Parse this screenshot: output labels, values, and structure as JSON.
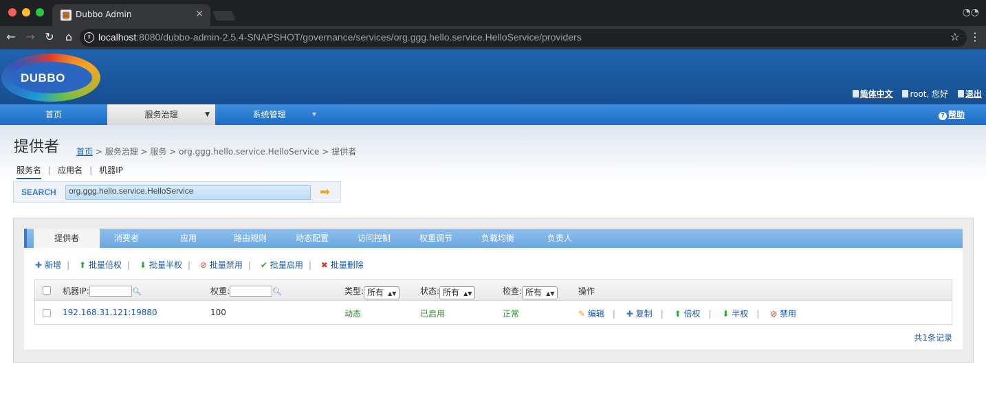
{
  "browser": {
    "tab_title": "Dubbo Admin",
    "tab_close": "×",
    "url_host": "localhost",
    "url_rest": ":8080/dubbo-admin-2.5.4-SNAPSHOT/governance/services/org.ggg.hello.service.HelloService/providers"
  },
  "header": {
    "logo_text": "DUBBO",
    "lang": "简体中文",
    "user": "root, 您好",
    "logout": "退出"
  },
  "mainnav": {
    "home": "首页",
    "governance": "服务治理",
    "system": "系统管理",
    "help": "帮助"
  },
  "page": {
    "title": "提供者",
    "breadcrumb_home": "首页",
    "breadcrumb_rest": " > 服务治理 > 服务 > org.ggg.hello.service.HelloService > 提供者"
  },
  "search": {
    "tabs": [
      "服务名",
      "应用名",
      "机器IP"
    ],
    "label": "SEARCH",
    "value": "org.ggg.hello.service.HelloService"
  },
  "tabs": [
    "提供者",
    "消费者",
    "应用",
    "路由规则",
    "动态配置",
    "访问控制",
    "权重调节",
    "负载均衡",
    "负责人"
  ],
  "actions": [
    "新增",
    "批量倍权",
    "批量半权",
    "批量禁用",
    "批量启用",
    "批量删除"
  ],
  "table": {
    "headers": {
      "ip": "机器IP:",
      "weight": "权重:",
      "type": "类型:",
      "status": "状态:",
      "check": "检查:",
      "ops": "操作",
      "select_all": "所有"
    },
    "rows": [
      {
        "ip": "192.168.31.121:19880",
        "weight": "100",
        "type": "动态",
        "status": "已启用",
        "check": "正常",
        "ops": [
          "编辑",
          "复制",
          "倍权",
          "半权",
          "禁用"
        ]
      }
    ],
    "footer": "共1条记录"
  },
  "colors": {
    "header_blue": "#1f63ad",
    "nav_blue": "#1c6cc6",
    "link_blue": "#1a5aa8",
    "tab_blue": "#6aa6e0"
  }
}
